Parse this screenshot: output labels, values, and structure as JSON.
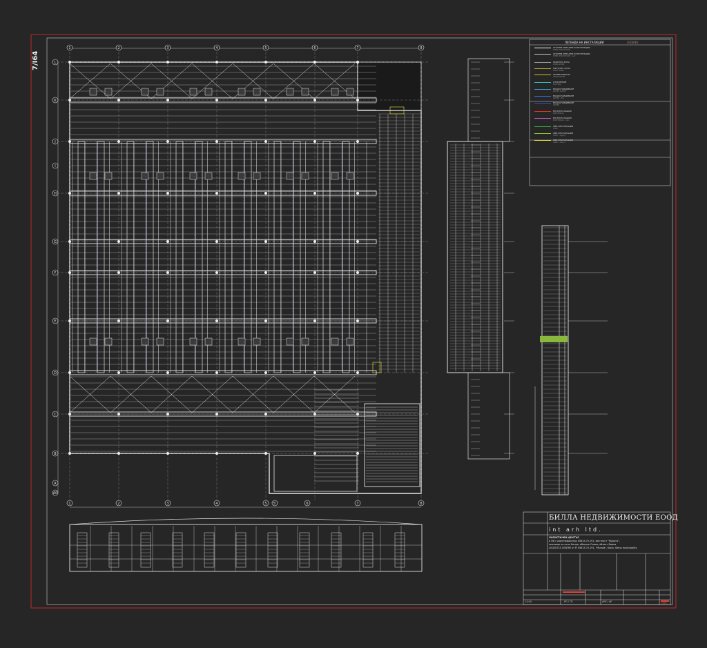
{
  "sheet": {
    "number": "7/I64"
  },
  "colors": {
    "background": "#262626",
    "border": "#c0282a",
    "lines": "#e8e8e8",
    "accent_yellow": "#d8d23a",
    "accent_green": "#8ab83c",
    "accent_purple": "#6a58c8"
  },
  "grid_axes": {
    "columns_top": [
      "1",
      "2",
      "3",
      "4",
      "5",
      "6",
      "7",
      "8"
    ],
    "columns_bottom": [
      "1",
      "2",
      "3",
      "4",
      "5",
      "5'",
      "6",
      "7",
      "8"
    ],
    "rows": [
      "L",
      "K",
      "J",
      "I",
      "H",
      "G",
      "F",
      "E",
      "D",
      "C",
      "B",
      "A",
      "A0"
    ]
  },
  "legend": {
    "title": "ЛЕГЕНДА НА ИНСТАЛАЦИИ",
    "subtitle": "LEGEND",
    "items": [
      {
        "label": "ОПОРНИ МЕТАЛНИ КОНСТРУКЦИИ",
        "sub": "STEEL STRUCTURE",
        "color": "#ffffff"
      },
      {
        "label": "ОПОРНИ МЕТАЛНИ КОНСТРУКЦИИ",
        "sub": "STEEL STRUCTURE - roof",
        "color": "#cccccc"
      },
      {
        "label": "РАБОТНА ЗОНА",
        "sub": "WORK ZONE",
        "color": "#9a9a9a"
      },
      {
        "label": "ПЯСЪЧНА ЗОНА",
        "sub": "SAND ZONE",
        "color": "#c8a33a"
      },
      {
        "label": "ПРОВЕТРЯВАНЕ",
        "sub": "VENTILATION",
        "color": "#d6c43a"
      },
      {
        "label": "ОТОПЛЕНИЕ",
        "sub": "HEATING",
        "color": "#3ab8b8"
      },
      {
        "label": "ВОДОСНАБДЯВАНЕ",
        "sub": "WATER SUPPLY",
        "color": "#3aa0d8"
      },
      {
        "label": "ВОДОСНАБДЯВАНЕ",
        "sub": "WATER - fire",
        "color": "#3a6ed8"
      },
      {
        "label": "ВОДОСНАБДЯВАНЕ",
        "sub": "WATER",
        "color": "#4a4ad8"
      },
      {
        "label": "ЕЛ ИНСТАЛАЦИЯ",
        "sub": "ELECTRICAL",
        "color": "#e03030"
      },
      {
        "label": "ЕЛ ИНСТАЛАЦИЯ",
        "sub": "ELECTRICAL - low",
        "color": "#c05ac0"
      },
      {
        "label": "ОВК ИНСТАЛАЦИЯ",
        "sub": "HVAC",
        "color": "#3aa04a"
      },
      {
        "label": "ОВК ИНСТАЛАЦИЯ",
        "sub": "HVAC - supply",
        "color": "#8ac83a"
      },
      {
        "label": "ОВК ИНСТАЛАЦИЯ",
        "sub": "HVAC - return",
        "color": "#d8d83a"
      }
    ]
  },
  "title_block": {
    "client": "БИЛЛА НЕДВИЖИМОСТИ ЕООД",
    "designer_logo": "int arh ltd.",
    "project_lines": [
      "ЛОГИСТИЧЕН ЦЕНТЪР",
      "в ПИ с идентификатор 05815.75.191, местност \"Мурата\",",
      "землище на село Кипра, община Опака, област Варна",
      "LOGISTICS CENTRE in PI 05815.75.191, \"Murata\", Kipra, Varna municipality"
    ],
    "scale": "1:200",
    "phase": "РП / ТП",
    "part": "АРХ / АР",
    "sheet_no": "7/I64"
  }
}
